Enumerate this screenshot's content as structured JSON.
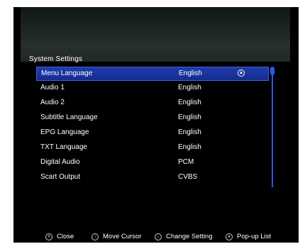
{
  "page_title": "System Settings",
  "settings": [
    {
      "label": "Menu Language",
      "value": "English"
    },
    {
      "label": "Audio 1",
      "value": "English"
    },
    {
      "label": "Audio 2",
      "value": "English"
    },
    {
      "label": "Subtitle Language",
      "value": "English"
    },
    {
      "label": "EPG Language",
      "value": "English"
    },
    {
      "label": "TXT Language",
      "value": "English"
    },
    {
      "label": "Digital Audio",
      "value": "PCM"
    },
    {
      "label": "Scart Output",
      "value": "CVBS"
    }
  ],
  "footer": {
    "close": "Close",
    "move_cursor": "Move Cursor",
    "change_setting": "Change Setting",
    "popup_list": "Pop-up List"
  },
  "colors": {
    "selection": "#1f3aa8",
    "scrollbar": "#2a59e8"
  }
}
